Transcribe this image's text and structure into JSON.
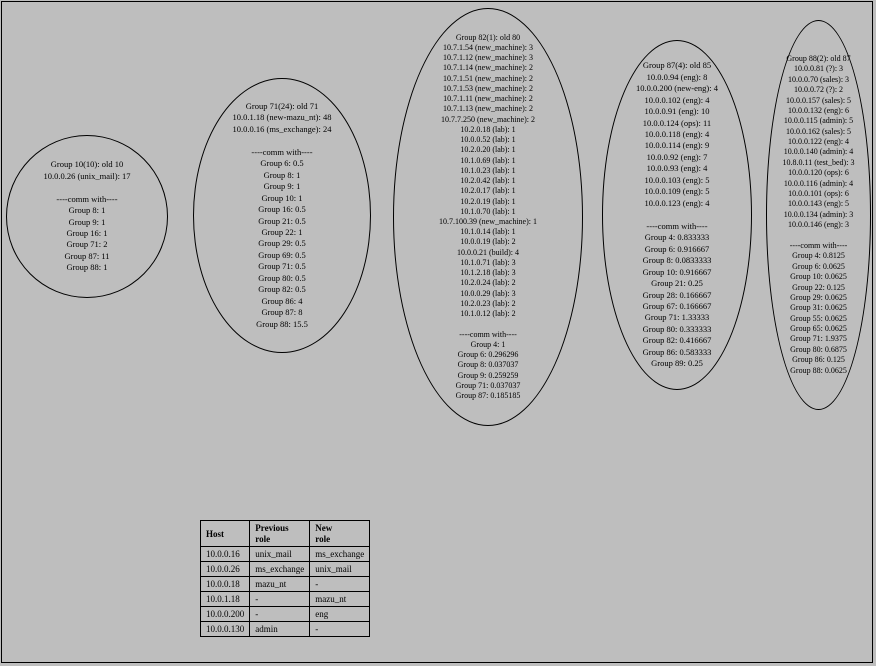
{
  "g10": {
    "title": "Group 10(10): old 10",
    "l0": "10.0.0.26 (unix_mail): 17",
    "sep": "----comm with----",
    "c0": "Group 8: 1",
    "c1": "Group 9: 1",
    "c2": "Group 16: 1",
    "c3": "Group 71: 2",
    "c4": "Group 87: 11",
    "c5": "Group 88: 1"
  },
  "g71": {
    "title": "Group 71(24): old 71",
    "l0": "10.0.1.18 (new-mazu_nt): 48",
    "l1": "10.0.0.16 (ms_exchange): 24",
    "sep": "----comm with----",
    "c0": "Group 6: 0.5",
    "c1": "Group 8: 1",
    "c2": "Group 9: 1",
    "c3": "Group 10: 1",
    "c4": "Group 16: 0.5",
    "c5": "Group 21: 0.5",
    "c6": "Group 22: 1",
    "c7": "Group 29: 0.5",
    "c8": "Group 69: 0.5",
    "c9": "Group 71: 0.5",
    "c10": "Group 80: 0.5",
    "c11": "Group 82: 0.5",
    "c12": "Group 86: 4",
    "c13": "Group 87: 8",
    "c14": "Group 88: 15.5"
  },
  "g82": {
    "title": "Group 82(1): old 80",
    "l0": "10.7.1.54 (new_machine): 3",
    "l1": "10.7.1.12 (new_machine): 3",
    "l2": "10.7.1.14 (new_machine): 2",
    "l3": "10.7.1.51 (new_machine): 2",
    "l4": "10.7.1.53 (new_machine): 2",
    "l5": "10.7.1.11 (new_machine): 2",
    "l6": "10.7.1.13 (new_machine): 2",
    "l7": "10.7.7.250 (new_machine): 2",
    "l8": "10.2.0.18 (lab): 1",
    "l9": "10.0.0.52 (lab): 1",
    "l10": "10.2.0.20 (lab): 1",
    "l11": "10.1.0.69 (lab): 1",
    "l12": "10.1.0.23 (lab): 1",
    "l13": "10.2.0.42 (lab): 1",
    "l14": "10.2.0.17 (lab): 1",
    "l15": "10.2.0.19 (lab): 1",
    "l16": "10.1.0.70 (lab): 1",
    "l17": "10.7.100.39 (new_machine): 1",
    "l18": "10.1.0.14 (lab): 1",
    "l19": "10.0.0.19 (lab): 2",
    "l20": "10.0.0.21 (build): 4",
    "l21": "10.1.0.71 (lab): 3",
    "l22": "10.1.2.18 (lab): 3",
    "l23": "10.2.0.24 (lab): 2",
    "l24": "10.0.0.29 (lab): 3",
    "l25": "10.2.0.23 (lab): 2",
    "l26": "10.1.0.12 (lab): 2",
    "sep": "----comm with----",
    "c0": "Group 4: 1",
    "c1": "Group 6: 0.296296",
    "c2": "Group 8: 0.037037",
    "c3": "Group 9: 0.259259",
    "c4": "Group 71: 0.037037",
    "c5": "Group 87: 0.185185"
  },
  "g87": {
    "title": "Group 87(4): old 85",
    "l0": "10.0.0.94 (eng): 8",
    "l1": "10.0.0.200 (new-eng): 4",
    "l2": "10.0.0.102 (eng): 4",
    "l3": "10.0.0.91 (eng): 10",
    "l4": "10.0.0.124 (ops): 11",
    "l5": "10.0.0.118 (eng): 4",
    "l6": "10.0.0.114 (eng): 9",
    "l7": "10.0.0.92 (eng): 7",
    "l8": "10.0.0.93 (eng): 4",
    "l9": "10.0.0.103 (eng): 5",
    "l10": "10.0.0.109 (eng): 5",
    "l11": "10.0.0.123 (eng): 4",
    "sep": "----comm with----",
    "c0": "Group 4: 0.833333",
    "c1": "Group 6: 0.916667",
    "c2": "Group 8: 0.0833333",
    "c3": "Group 10: 0.916667",
    "c4": "Group 21: 0.25",
    "c5": "Group 28: 0.166667",
    "c6": "Group 67: 0.166667",
    "c7": "Group 71: 1.33333",
    "c8": "Group 80: 0.333333",
    "c9": "Group 82: 0.416667",
    "c10": "Group 86: 0.583333",
    "c11": "Group 89: 0.25"
  },
  "g88": {
    "title": "Group 88(2): old 87",
    "l0": "10.0.0.81 (?): 3",
    "l1": "10.0.0.70 (sales): 3",
    "l2": "10.0.0.72 (?): 2",
    "l3": "10.0.0.157 (sales): 5",
    "l4": "10.0.0.132 (eng): 6",
    "l5": "10.0.0.115 (admin): 5",
    "l6": "10.0.0.162 (sales): 5",
    "l7": "10.0.0.122 (eng): 4",
    "l8": "10.0.0.140 (admin): 4",
    "l9": "10.8.0.11 (test_bed): 3",
    "l10": "10.0.0.120 (ops): 6",
    "l11": "10.0.0.116 (admin): 4",
    "l12": "10.0.0.101 (ops): 6",
    "l13": "10.0.0.143 (eng): 5",
    "l14": "10.0.0.134 (admin): 3",
    "l15": "10.0.0.146 (eng): 3",
    "sep": "----comm with----",
    "c0": "Group 4: 0.8125",
    "c1": "Group 6: 0.0625",
    "c2": "Group 10: 0.0625",
    "c3": "Group 22: 0.125",
    "c4": "Group 29: 0.0625",
    "c5": "Group 31: 0.0625",
    "c6": "Group 55: 0.0625",
    "c7": "Group 65: 0.0625",
    "c8": "Group 71: 1.9375",
    "c9": "Group 80: 0.6875",
    "c10": "Group 86: 0.125",
    "c11": "Group 88: 0.0625"
  },
  "tbl": {
    "h0": "Host",
    "h1a": "Previous",
    "h1b": "role",
    "h2a": "New",
    "h2b": "role",
    "r": [
      {
        "a": "10.0.0.16",
        "b": "unix_mail",
        "c": "ms_exchange"
      },
      {
        "a": "10.0.0.26",
        "b": "ms_exchange",
        "c": "unix_mail"
      },
      {
        "a": "10.0.0.18",
        "b": "mazu_nt",
        "c": "-"
      },
      {
        "a": "10.0.1.18",
        "b": "-",
        "c": "mazu_nt"
      },
      {
        "a": "10.0.0.200",
        "b": "-",
        "c": "eng"
      },
      {
        "a": "10.0.0.130",
        "b": "admin",
        "c": "-"
      }
    ]
  }
}
